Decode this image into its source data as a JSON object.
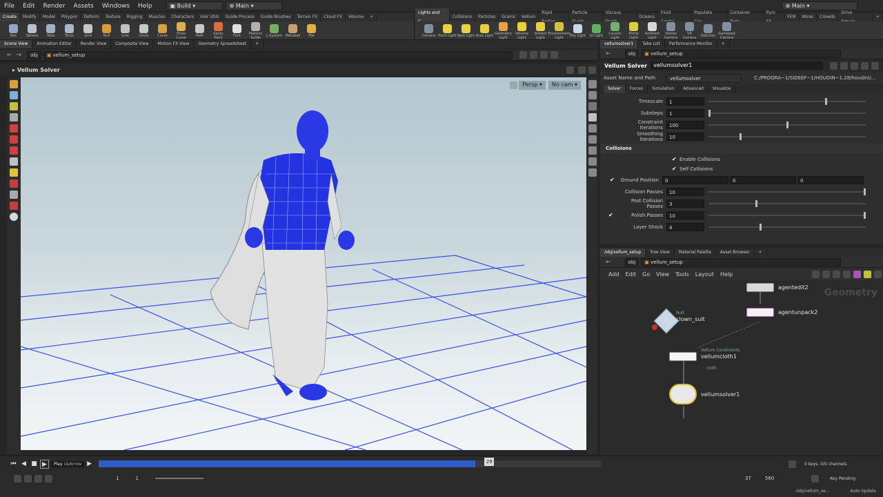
{
  "menubar": {
    "items": [
      "File",
      "Edit",
      "Render",
      "Assets",
      "Windows",
      "Help"
    ],
    "desktop_dropdown": "Build",
    "main_dropdown": "Main",
    "right_dropdown": "Main"
  },
  "shelf_left": {
    "tabs": [
      "Create",
      "Modify",
      "Model",
      "Polygon",
      "Deform",
      "Texture",
      "Rigging",
      "Muscles",
      "Characters",
      "Hair Utils",
      "Guide Process",
      "Guide Brushes",
      "Terrain FX",
      "Cloud FX",
      "Volume"
    ],
    "tools": [
      {
        "label": "Box",
        "color": "#8fa8c8"
      },
      {
        "label": "Sphere",
        "color": "#b9c2cc"
      },
      {
        "label": "Tube",
        "color": "#9fb2c5"
      },
      {
        "label": "Torus",
        "color": "#a8b8c8"
      },
      {
        "label": "Grid",
        "color": "#c8c8c8"
      },
      {
        "label": "Null",
        "color": "#d89a3a"
      },
      {
        "label": "Line",
        "color": "#c0c0c0"
      },
      {
        "label": "Circle",
        "color": "#c8c8c8"
      },
      {
        "label": "Curve",
        "color": "#d8a040"
      },
      {
        "label": "Draw Curve",
        "color": "#d8b050"
      },
      {
        "label": "Path",
        "color": "#c8c8c8"
      },
      {
        "label": "Spray Paint",
        "color": "#d87040"
      },
      {
        "label": "Font",
        "color": "#e0e0e0"
      },
      {
        "label": "Platonic Solids",
        "color": "#b0b0b0"
      },
      {
        "label": "L-System",
        "color": "#70b060"
      },
      {
        "label": "Metaball",
        "color": "#c8a070"
      },
      {
        "label": "File",
        "color": "#e0b040"
      }
    ]
  },
  "shelf_right": {
    "tabs": [
      "Lights and C...",
      "Collisions",
      "Particles",
      "Grains",
      "Vellum",
      "Rigid Bodies",
      "Particle Fluids",
      "Viscous Fluids",
      "Oceans",
      "Fluid Contai...",
      "Populate Con...",
      "Container Tools",
      "Pyro FX",
      "FEM",
      "Wires",
      "Crowds",
      "Drive Simula..."
    ],
    "tools": [
      {
        "label": "Camera",
        "color": "#8090a0"
      },
      {
        "label": "Point Light",
        "color": "#e8d040"
      },
      {
        "label": "Spot Light",
        "color": "#e8d040"
      },
      {
        "label": "Area Light",
        "color": "#e8d040"
      },
      {
        "label": "Geometry Light",
        "color": "#e8a040"
      },
      {
        "label": "Volume Light",
        "color": "#e8d040"
      },
      {
        "label": "Distant Light",
        "color": "#e8d040"
      },
      {
        "label": "Environment Light",
        "color": "#d8c040"
      },
      {
        "label": "Sky Light",
        "color": "#c8d8e8"
      },
      {
        "label": "GI Light",
        "color": "#60b060"
      },
      {
        "label": "Caustic Light",
        "color": "#70b070"
      },
      {
        "label": "Portal Light",
        "color": "#d8d040"
      },
      {
        "label": "Ambient Light",
        "color": "#d8d8d8"
      },
      {
        "label": "Stereo Camera",
        "color": "#8090a0"
      },
      {
        "label": "VR Camera",
        "color": "#8090a0"
      },
      {
        "label": "Switcher",
        "color": "#8090a0"
      },
      {
        "label": "Gamepad Camera",
        "color": "#8090a0"
      }
    ]
  },
  "left_pane": {
    "tabs": [
      "Scene View",
      "Animation Editor",
      "Render View",
      "Composite View",
      "Motion FX View",
      "Geometry Spreadsheet"
    ],
    "path_obj": "obj",
    "path_node": "vellum_setup",
    "tool_title": "Vellum Solver",
    "persp": "Persp",
    "cam": "No cam"
  },
  "params_pane": {
    "tabs": [
      "vellumsolver1",
      "Take List",
      "Performance Monitor"
    ],
    "path_obj": "obj",
    "path_node": "vellum_setup",
    "node_type": "Vellum Solver",
    "node_name": "vellumsolver1",
    "asset_label": "Asset Name and Path",
    "asset_name": "vellumsolver",
    "asset_path": "C:/PROGRA~1/SIDEEF~1/HOUDIN~1.28/houdini/...",
    "sub_tabs": [
      "Solver",
      "Forces",
      "Simulation",
      "Advanced",
      "Visualize"
    ],
    "rows": [
      {
        "label": "Timescale",
        "value": "1",
        "slider": 0.75
      },
      {
        "label": "Substeps",
        "value": "1",
        "slider": 0.0
      },
      {
        "label": "Constraint Iterations",
        "value": "100",
        "slider": 0.5
      },
      {
        "label": "Smoothing Iterations",
        "value": "10",
        "slider": 0.2
      }
    ],
    "collisions_header": "Collisions",
    "enable_collisions": "Enable Collisions",
    "self_collisions": "Self Collisions",
    "ground_label": "Ground Position",
    "ground_values": [
      "0",
      "0",
      "0"
    ],
    "rows2": [
      {
        "label": "Collision Passes",
        "value": "10",
        "slider": 1.0
      },
      {
        "label": "Post Collision Passes",
        "value": "3",
        "slider": 0.3
      },
      {
        "label": "Polish Passes",
        "value": "10",
        "slider": 1.0
      },
      {
        "label": "Layer Shock",
        "value": "4",
        "slider": 0.33
      }
    ]
  },
  "network_pane": {
    "tabs": [
      "/obj/vellum_setup",
      "Tree View",
      "Material Palette",
      "Asset Browser"
    ],
    "path_obj": "obj",
    "path_node": "vellum_setup",
    "menu": [
      "Add",
      "Edit",
      "Go",
      "View",
      "Tools",
      "Layout",
      "Help"
    ],
    "context_label": "Geometry",
    "nodes": {
      "agentedit": "agentedit2",
      "agentunpack": "agentunpack2",
      "clown_suit": "clown_suit",
      "clown_suit_sub": "Null",
      "vellumcloth_type": "Vellum Constraints",
      "vellumcloth": "vellumcloth1",
      "vellumcloth_sub": "cloth",
      "vellumsolver": "vellumsolver1"
    }
  },
  "timeline": {
    "play_tooltip": "Play",
    "play_shortcut": "UpArrow",
    "current_frame": "29",
    "start": "1",
    "start2": "1",
    "range_end": "37",
    "end": "560",
    "keys_label": "0 keys, 0/0 channels",
    "key_pending": "Key Pending",
    "status_path": "/obj/vellum_se...",
    "auto_update": "Auto Update"
  },
  "colors": {
    "accent_blue": "#1f3be0",
    "timeline_blue": "#2f5cc6",
    "grid_line": "#3a4fe8"
  }
}
